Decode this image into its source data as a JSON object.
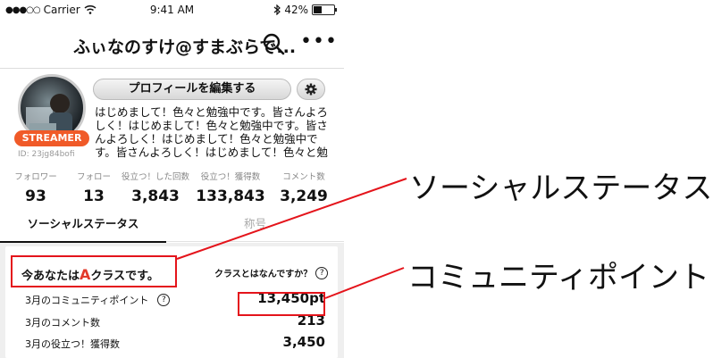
{
  "status_bar": {
    "carrier": "Carrier",
    "time": "9:41 AM",
    "battery": "42%",
    "battery_level": 0.42
  },
  "nav": {
    "title": "ふぃなのすけ@すまぶらで...",
    "search_icon": "search-icon",
    "more_label": "•••"
  },
  "profile": {
    "edit_button": "プロフィールを編集する",
    "badge": "STREAMER",
    "user_id": "ID: 23jg84bofi",
    "bio": "はじめまして！色々と勉強中です。皆さんよろしく！はじめまして！色々と勉強中です。皆さんよろしく！はじめまして！色々と勉強中です。皆さんよろしく！はじめまして！色々と勉"
  },
  "stats": [
    {
      "label": "フォロワー",
      "value": "93"
    },
    {
      "label": "フォロー",
      "value": "13"
    },
    {
      "label": "役立つ！した回数",
      "value": "3,843"
    },
    {
      "label": "役立つ！獲得数",
      "value": "133,843"
    },
    {
      "label": "コメント数",
      "value": "3,249"
    }
  ],
  "tabs": {
    "social_status": "ソーシャルステータス",
    "title": "称号"
  },
  "class_card": {
    "prefix": "今あなたは",
    "grade": "A",
    "suffix": "クラスです。",
    "help": "クラスとはなんですか？",
    "rows": [
      {
        "label": "3月のコミュニティポイント",
        "value": "13,450pt"
      },
      {
        "label": "3月のコメント数",
        "value": "213"
      },
      {
        "label": "3月の役立つ！獲得数",
        "value": "3,450"
      }
    ]
  },
  "annotations": {
    "social_status": "ソーシャルステータス",
    "community_point": "コミュニティポイント",
    "color": "#e4141b"
  }
}
